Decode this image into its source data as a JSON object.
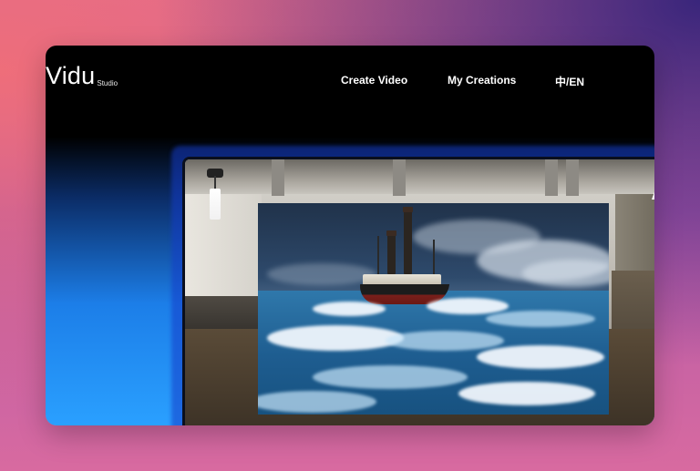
{
  "app": {
    "logo": {
      "main": "Vidu",
      "sub": "Studio"
    }
  },
  "nav": {
    "items": [
      {
        "label": "Create Video"
      },
      {
        "label": "My Creations"
      },
      {
        "label": "中/EN"
      }
    ]
  }
}
